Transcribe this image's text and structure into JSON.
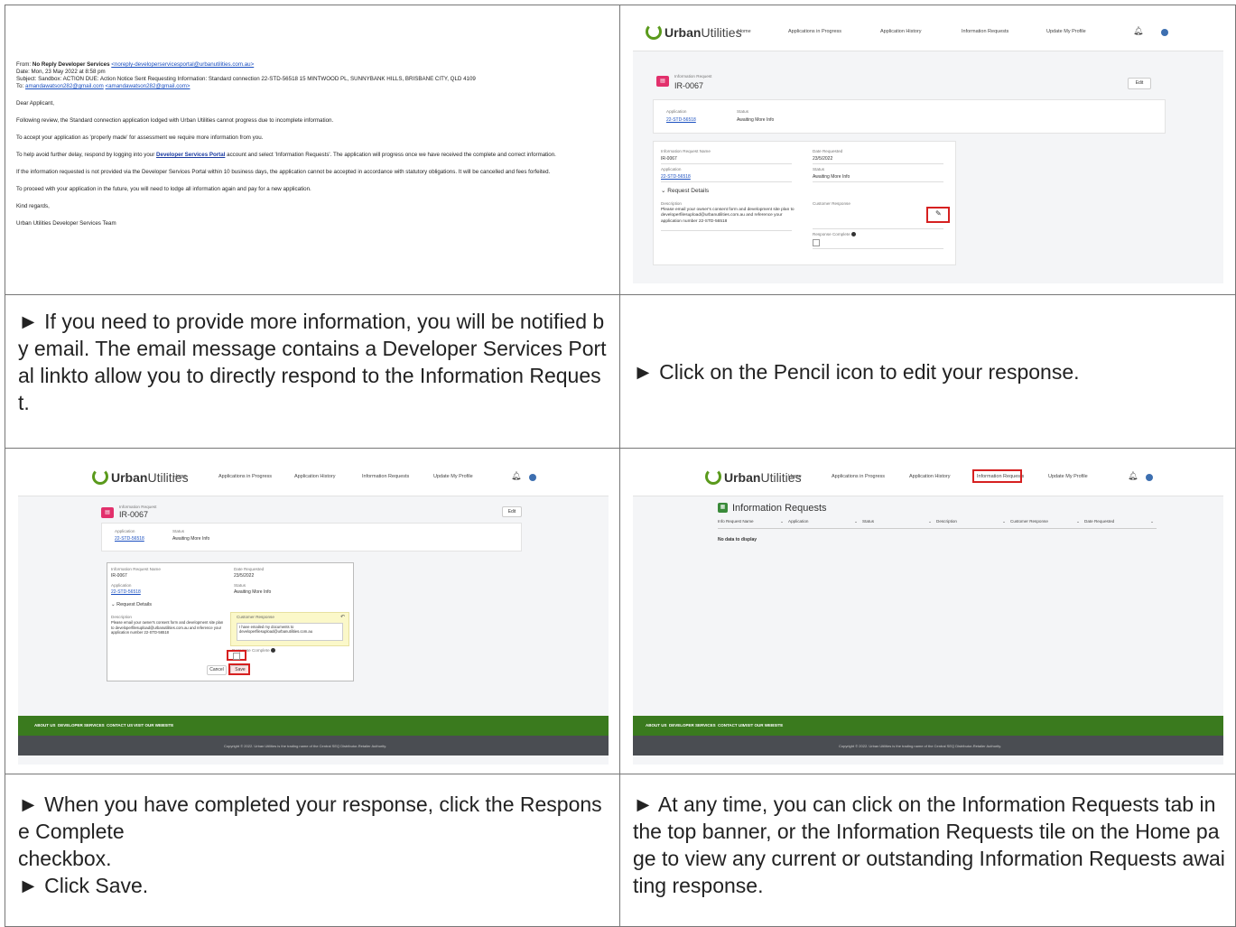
{
  "email": {
    "from_label": "From:",
    "from_name": "No Reply Developer Services",
    "from_addr": "<noreply-developerservicesportal@urbanutilities.com.au>",
    "date": "Date: Mon, 23 May 2022 at 8:58 pm",
    "subject": "Subject: Sandbox: ACTION DUE: Action Notice Sent Requesting Information: Standard connection 22-STD-56518 15 MINTWOOD PL, SUNNYBANK HILLS, BRISBANE CITY, QLD 4109",
    "to_label": "To:",
    "to_addr": "amandawatson282@gmail.com",
    "to_addr2": "<amandawatson282@gmail.com>",
    "greeting": "Dear Applicant,",
    "p1": "Following review, the Standard connection application lodged with Urban Utilities cannot progress due to incomplete information.",
    "p2": "To accept your application as 'properly made' for assessment we require more information from you.",
    "p3a": "To help avoid further delay, respond by logging into your",
    "p3link": "Developer Services Portal",
    "p3b": "account and select 'Information Requests'. The application will progress once we have received the complete and correct information.",
    "p4": "If the information requested is not provided via the Developer Services Portal within 10 business days, the application cannot be accepted in accordance with statutory obligations. It will be cancelled and fees forfeited.",
    "p5": "To proceed with your application in the future, you will need to lodge all information again and pay for a new application.",
    "p6": "Kind regards,",
    "p7": "Urban Utilities Developer Services Team"
  },
  "portal": {
    "logo_bold": "Urban",
    "logo_rest": "Utilities",
    "nav": [
      "Home",
      "Applications in Progress",
      "Application History",
      "Information Requests",
      "Update My Profile"
    ],
    "ir_label": "Information Request",
    "ir_id": "IR-0067",
    "edit": "Edit",
    "application_label": "Application",
    "application_value": "22-STD-56518",
    "status_label": "Status",
    "status_value": "Awaiting More Info",
    "ir_name_label": "Information Request Name",
    "ir_name_value": "IR-0067",
    "date_label": "Date Requested",
    "date_value": "23/5/2022",
    "request_details": "Request Details",
    "description_label": "Description",
    "description_value": "Please email your owner's consent form and development site plan to developerfilesupload@urbanutilities.com.au and reference your application number 22-STD-56518",
    "customer_response_label": "Customer Response",
    "response_complete_label": "Response Complete",
    "customer_response_text": "I have emailed my documents to developerfilesupload@urbanutilities.com.au",
    "cancel": "Cancel",
    "save": "Save",
    "ir_list_title": "Information Requests",
    "columns": [
      "Info Request Name",
      "Application",
      "Status",
      "Description",
      "Customer Response",
      "Date Requested"
    ],
    "no_data": "No data to display",
    "footer_links": [
      "ABOUT US",
      "DEVELOPER SERVICES",
      "CONTACT US",
      "VISIT OUR WEBSITE"
    ],
    "copyright": "Copyright © 2022. Urban Utilities is the trading name of the Central SEQ Distributor-Retailer Authority."
  },
  "captions": {
    "c1": "► If you need to provide more information, you will be notified by email. The email message contains a Developer Services Portal linkto allow you to directly respond to the Information Request.",
    "c2": "► Click on the Pencil icon to edit your response.",
    "c3": "► When you have completed your response, click the Response Complete\ncheckbox.\n► Click Save.",
    "c4": "► At any time, you can click on the Information Requests tab in the top banner, or the Information Requests tile on the Home page to view any current or outstanding Information Requests awaiting response."
  }
}
